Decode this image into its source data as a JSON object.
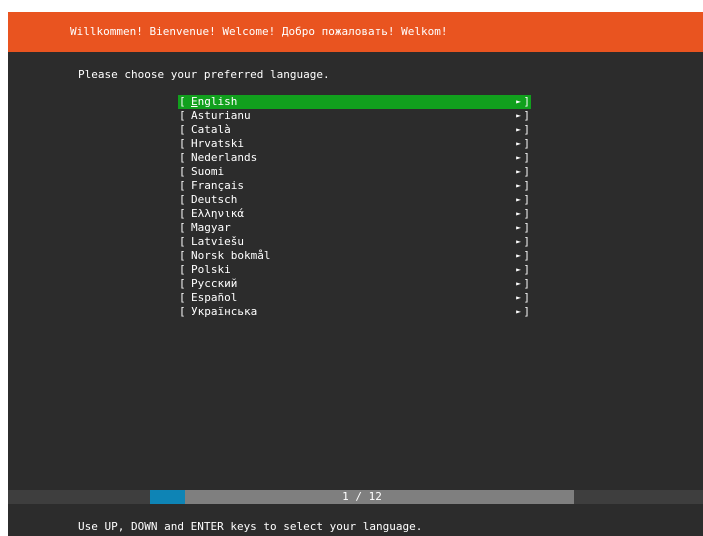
{
  "header": {
    "title": "Willkommen! Bienvenue! Welcome! Добро пожаловать! Welkom!"
  },
  "prompt": "Please choose your preferred language.",
  "languages": {
    "bracket_left": "[",
    "bracket_right": "]",
    "arrow": "►",
    "selected_index": 0,
    "items": [
      {
        "label": "English"
      },
      {
        "label": "Asturianu"
      },
      {
        "label": "Català"
      },
      {
        "label": "Hrvatski"
      },
      {
        "label": "Nederlands"
      },
      {
        "label": "Suomi"
      },
      {
        "label": "Français"
      },
      {
        "label": "Deutsch"
      },
      {
        "label": "Ελληνικά"
      },
      {
        "label": "Magyar"
      },
      {
        "label": "Latviešu"
      },
      {
        "label": "Norsk bokmål"
      },
      {
        "label": "Polski"
      },
      {
        "label": "Русский"
      },
      {
        "label": "Español"
      },
      {
        "label": "Українська"
      }
    ]
  },
  "progress": {
    "label": "1 / 12",
    "fraction": 0.0833
  },
  "footer": "Use UP, DOWN and ENTER keys to select your language.",
  "colors": {
    "header_bg": "#e95420",
    "screen_bg": "#2c2c2c",
    "selected_bg": "#11a01d",
    "progress_fill": "#0e84b5",
    "progress_track": "#7f7f7f"
  }
}
